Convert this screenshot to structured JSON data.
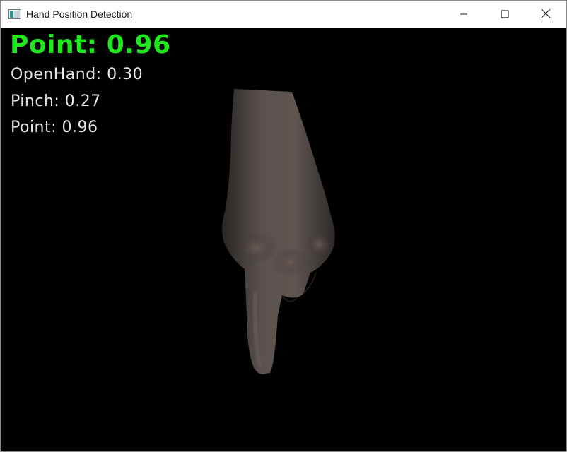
{
  "window": {
    "title": "Hand Position Detection",
    "icons": {
      "app": "app-window-icon",
      "minimize": "minimize-icon",
      "maximize": "maximize-icon",
      "close": "close-icon"
    }
  },
  "detection": {
    "top_prediction": "Point: 0.96",
    "top_color": "#1fe81f",
    "scores": [
      {
        "label": "OpenHand: 0.30",
        "value": 0.3
      },
      {
        "label": "Pinch: 0.27",
        "value": 0.27
      },
      {
        "label": "Point: 0.96",
        "value": 0.96
      }
    ]
  },
  "feed": {
    "background": "#000000",
    "subject": "hand pointing down"
  }
}
